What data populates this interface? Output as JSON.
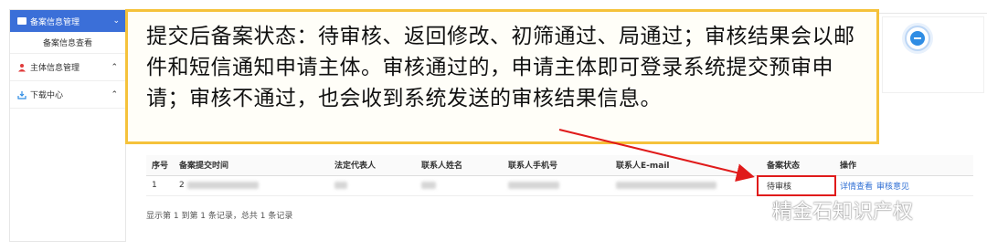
{
  "sidebar": {
    "header_label": "备案信息管理",
    "sub_item": "备案信息查看",
    "items": [
      {
        "label": "主体信息管理"
      },
      {
        "label": "下载中心"
      }
    ]
  },
  "callout": {
    "text": "提交后备案状态：待审核、返回修改、初筛通过、局通过；审核结果会以邮件和短信通知申请主体。审核通过的，申请主体即可登录系统提交预审申请；审核不通过，也会收到系统发送的审核结果信息。"
  },
  "table": {
    "headers": [
      "序号",
      "备案提交时间",
      "法定代表人",
      "联系人姓名",
      "联系人手机号",
      "联系人E-mail",
      "备案状态",
      "操作"
    ],
    "rows": [
      {
        "index": "1",
        "submit_time_prefix": "2",
        "status": "待审核",
        "actions": [
          "详情查看",
          "审核意见"
        ]
      }
    ],
    "footer": "显示第 1 到第 1 条记录，总共 1 条记录"
  },
  "watermark": {
    "text": "精金石知识产权"
  },
  "colors": {
    "sidebar_header": "#3b6fd8",
    "callout_border": "#f5c23b",
    "highlight": "#e01b1b",
    "link": "#2f6fd4"
  }
}
